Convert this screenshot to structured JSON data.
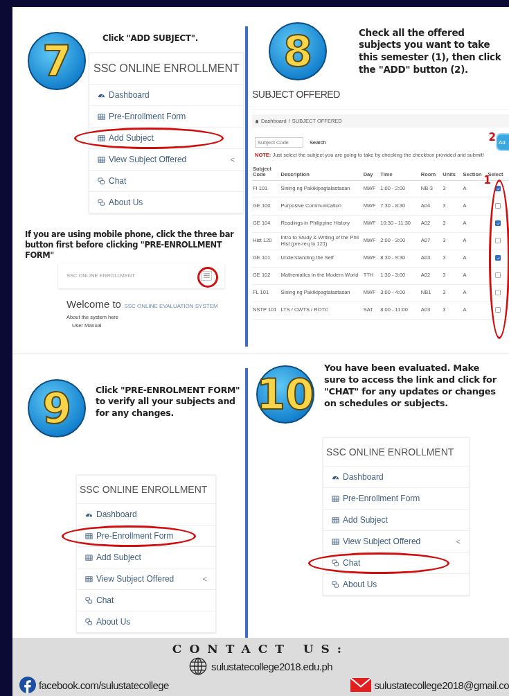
{
  "step7": {
    "number": "7",
    "instruction": "Click \"ADD SUBJECT\".",
    "menu": {
      "title": "SSC ONLINE ENROLLMENT",
      "items": [
        {
          "label": "Dashboard",
          "kind": "dashboard",
          "circled": false
        },
        {
          "label": "Pre-Enrollment Form",
          "kind": "table",
          "circled": false
        },
        {
          "label": "Add Subject",
          "kind": "table",
          "circled": true
        },
        {
          "label": "View Subject Offered",
          "kind": "table",
          "circled": false,
          "caret": "<"
        },
        {
          "label": "Chat",
          "kind": "chat",
          "circled": false
        },
        {
          "label": "About Us",
          "kind": "chat",
          "circled": false
        }
      ]
    },
    "mobile_note": "If you are using mobile phone, click the three bar button first before clicking \"PRE-ENROLLMENT FORM\"",
    "mobile": {
      "brand": "SSC ONLINE ENROLLMENT",
      "menu_circled": true,
      "welcome": "Welcome to",
      "system": "SSC ONLINE EVALUATION SYSTEM",
      "about": "About the system here",
      "manual": "User Manual"
    }
  },
  "step8": {
    "number": "8",
    "instruction": "Check all the offered subjects you want to take this semester (1), then click the \"ADD\" button (2).",
    "heading": "SUBJECT OFFERED",
    "breadcrumb": [
      "Dashboard",
      "/",
      "SUBJECT OFFERED"
    ],
    "search": {
      "placeholder": "Subject Code",
      "button": "Search"
    },
    "add_button": "Ad",
    "mark_add": "2",
    "mark_select": "1",
    "select_circled": true,
    "note_label": "NOTE:",
    "note": "Just select the subject you are going to take by checking the checkbox provided and submit!",
    "columns": [
      "Subject Code",
      "Description",
      "Day",
      "Time",
      "Room",
      "Units",
      "Section",
      "Select"
    ],
    "rows": [
      {
        "code": "FI 101",
        "description": "Sining ng Pakikipagtalastasan",
        "day": "MWF",
        "time": "1:00 - 2:00",
        "room": "NB-3",
        "units": "3",
        "section": "A",
        "checked": true
      },
      {
        "code": "GE 100",
        "description": "Purposive Communication",
        "day": "MWF",
        "time": "7:30 - 8:30",
        "room": "A04",
        "units": "3",
        "section": "A",
        "checked": false
      },
      {
        "code": "GE 104",
        "description": "Readings in Philippine History",
        "day": "MWF",
        "time": "10:30 - 11:30",
        "room": "A02",
        "units": "3",
        "section": "A",
        "checked": true
      },
      {
        "code": "Hist 120",
        "description": "Intro to Study & Writing of the Phil Hist (pre-req to 121)",
        "day": "MWF",
        "time": "2:00 - 3:00",
        "room": "A07",
        "units": "3",
        "section": "A",
        "checked": false
      },
      {
        "code": "GE 101",
        "description": "Understanding the Self",
        "day": "MWF",
        "time": "8:30 - 9:30",
        "room": "A03",
        "units": "3",
        "section": "A",
        "checked": true
      },
      {
        "code": "GE 102",
        "description": "Mathematics in the Modern World",
        "day": "TTH",
        "time": "1:30 - 3:00",
        "room": "A02",
        "units": "3",
        "section": "A",
        "checked": false
      },
      {
        "code": "FL 101",
        "description": "Sining ng Pakikipagtalastasan",
        "day": "MWF",
        "time": "3:00 - 4:00",
        "room": "NB1",
        "units": "3",
        "section": "A",
        "checked": false
      },
      {
        "code": "NSTP 101",
        "description": "LTS / CWTS / ROTC",
        "day": "SAT",
        "time": "8:00 - 11:00",
        "room": "A03",
        "units": "3",
        "section": "A",
        "checked": false
      }
    ]
  },
  "step9": {
    "number": "9",
    "instruction": "Click \"PRE-ENROLMENT FORM\" to verify all your subjects and for any changes.",
    "menu": {
      "title": "SSC ONLINE ENROLLMENT",
      "items": [
        {
          "label": "Dashboard",
          "kind": "dashboard",
          "circled": false
        },
        {
          "label": "Pre-Enrollment Form",
          "kind": "table",
          "circled": true
        },
        {
          "label": "Add Subject",
          "kind": "table",
          "circled": false
        },
        {
          "label": "View Subject Offered",
          "kind": "table",
          "circled": false,
          "caret": "<"
        },
        {
          "label": "Chat",
          "kind": "chat",
          "circled": false
        },
        {
          "label": "About Us",
          "kind": "chat",
          "circled": false
        }
      ]
    }
  },
  "step10": {
    "number": "10",
    "instruction": "You have been evaluated. Make sure to access the link and click for \"CHAT\" for any updates or changes on schedules or subjects.",
    "menu": {
      "title": "SSC ONLINE ENROLLMENT",
      "items": [
        {
          "label": "Dashboard",
          "kind": "dashboard",
          "circled": false
        },
        {
          "label": "Pre-Enrollment Form",
          "kind": "table",
          "circled": false
        },
        {
          "label": "Add Subject",
          "kind": "table",
          "circled": false
        },
        {
          "label": "View Subject Offered",
          "kind": "table",
          "circled": false,
          "caret": "<"
        },
        {
          "label": "Chat",
          "kind": "chat",
          "circled": true
        },
        {
          "label": "About Us",
          "kind": "chat",
          "circled": false
        }
      ]
    }
  },
  "footer": {
    "title": "CONTACT US:",
    "website": "sulustatecollege2018.edu.ph",
    "facebook": "facebook.com/sulustatecollege",
    "email": "sulustatecollege2018@gmail.co"
  }
}
